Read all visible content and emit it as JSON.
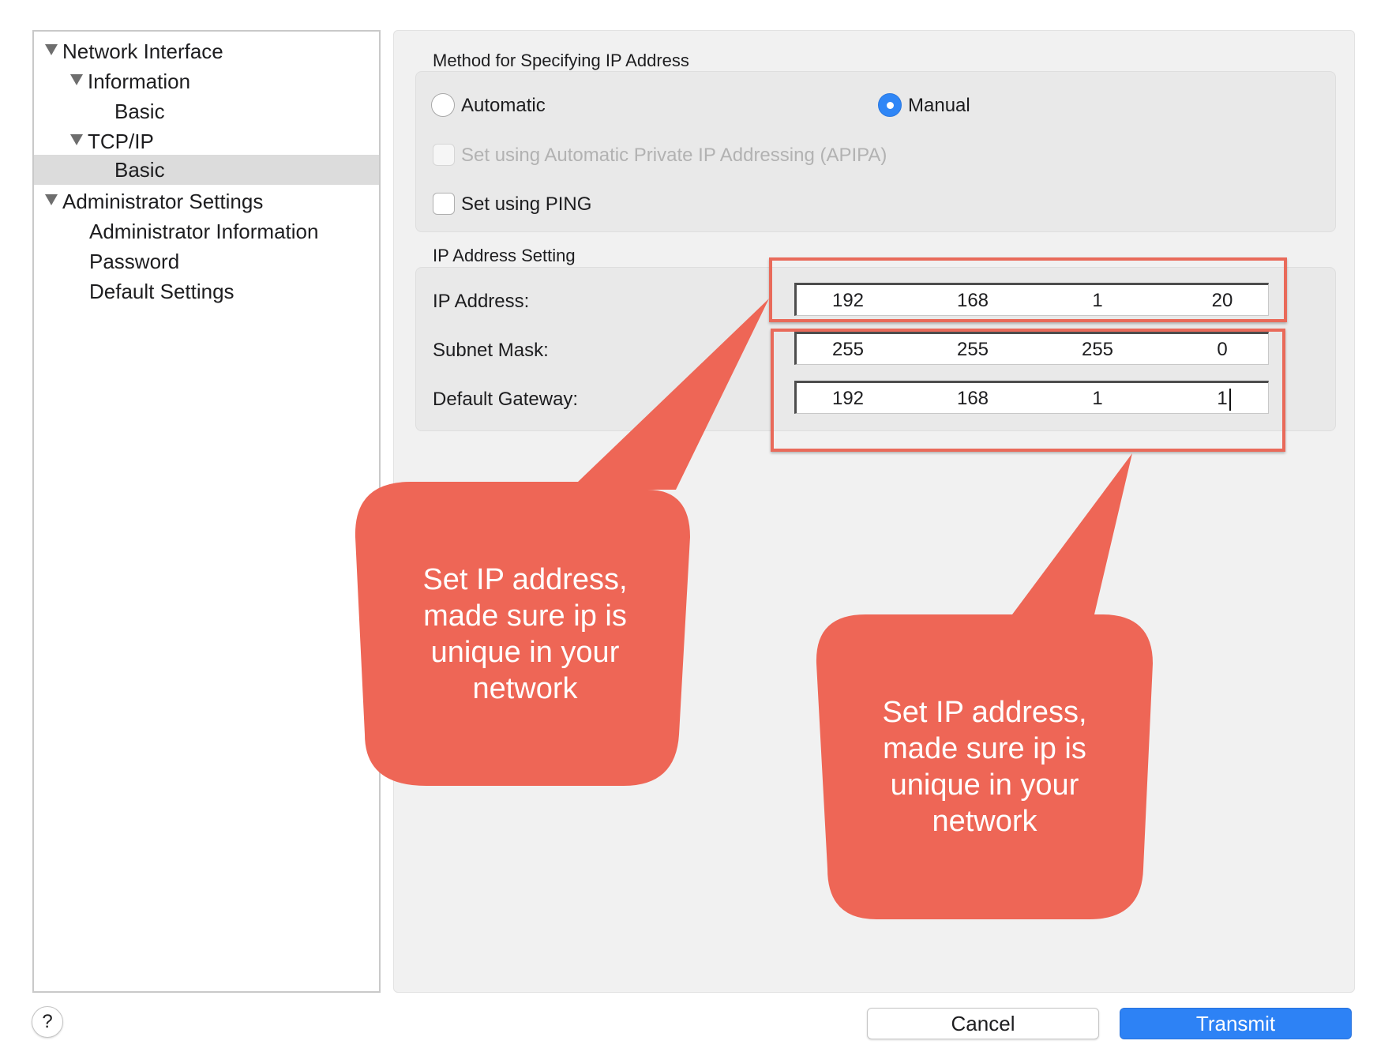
{
  "sidebar": {
    "items": [
      {
        "label": "Network Interface",
        "level": 0,
        "expanded": true,
        "selected": false
      },
      {
        "label": "Information",
        "level": 1,
        "expanded": true,
        "selected": false
      },
      {
        "label": "Basic",
        "level": 2,
        "expanded": false,
        "selected": false
      },
      {
        "label": "TCP/IP",
        "level": 1,
        "expanded": true,
        "selected": false
      },
      {
        "label": "Basic",
        "level": 2,
        "expanded": false,
        "selected": true
      },
      {
        "label": "Administrator Settings",
        "level": 0,
        "expanded": true,
        "selected": false
      },
      {
        "label": "Administrator Information",
        "level": 1,
        "expanded": false,
        "selected": false
      },
      {
        "label": "Password",
        "level": 1,
        "expanded": false,
        "selected": false
      },
      {
        "label": "Default Settings",
        "level": 1,
        "expanded": false,
        "selected": false
      }
    ]
  },
  "method": {
    "title": "Method for Specifying IP Address",
    "automatic_label": "Automatic",
    "manual_label": "Manual",
    "selected": "Manual",
    "apipa_label": "Set using Automatic Private IP Addressing (APIPA)",
    "apipa_checked": false,
    "apipa_enabled": false,
    "ping_label": "Set using PING",
    "ping_checked": false
  },
  "ip_setting": {
    "title": "IP Address Setting",
    "ip_address": {
      "label": "IP Address:",
      "octets": [
        "192",
        "168",
        "1",
        "20"
      ]
    },
    "subnet_mask": {
      "label": "Subnet Mask:",
      "octets": [
        "255",
        "255",
        "255",
        "0"
      ]
    },
    "default_gateway": {
      "label": "Default Gateway:",
      "octets": [
        "192",
        "168",
        "1",
        "1"
      ]
    }
  },
  "callouts": {
    "left_text": "Set IP address,\nmade sure ip is\nunique in your\nnetwork",
    "right_text": "Set IP address,\nmade sure ip is\nunique in your\nnetwork",
    "color": "#ee6656"
  },
  "footer": {
    "help_label": "?",
    "cancel_label": "Cancel",
    "transmit_label": "Transmit"
  },
  "colors": {
    "accent": "#2d82f5",
    "highlight": "#e96a5a",
    "selection": "#dcdcdc"
  }
}
